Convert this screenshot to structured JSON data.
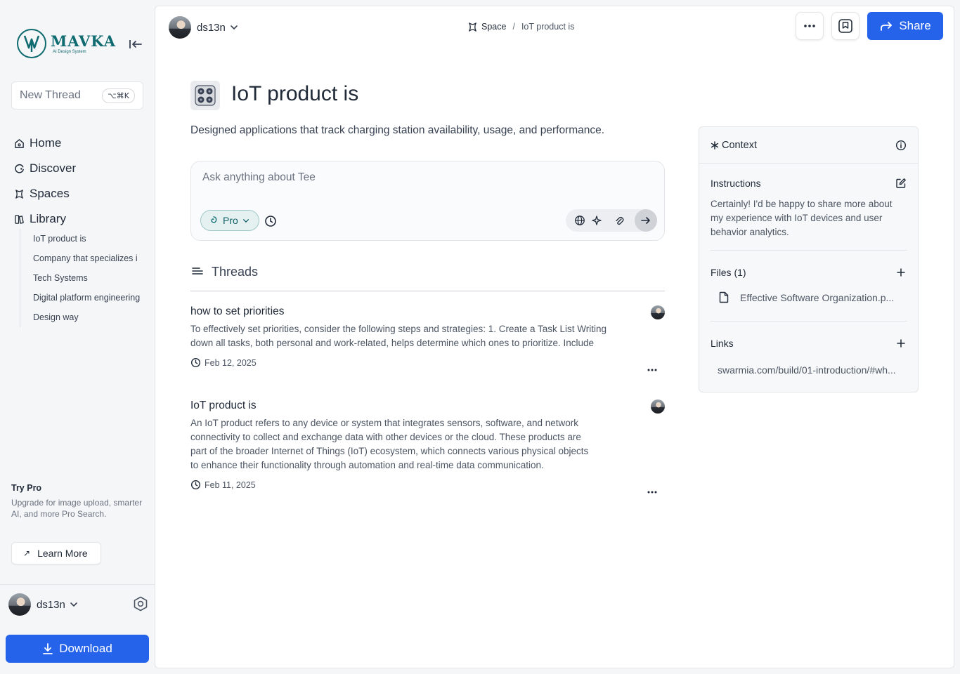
{
  "sidebar": {
    "brand_name": "MAVKA",
    "brand_tagline": "AI Design System",
    "new_thread": {
      "label": "New Thread",
      "shortcut": "⌥⌘K"
    },
    "nav": [
      {
        "label": "Home",
        "icon": "home-icon"
      },
      {
        "label": "Discover",
        "icon": "discover-icon"
      },
      {
        "label": "Spaces",
        "icon": "spaces-icon"
      },
      {
        "label": "Library",
        "icon": "library-icon"
      }
    ],
    "library_items": [
      "IoT product is",
      "Company that specializes i",
      "Tech Systems",
      "Digital platform engineering",
      "Design way"
    ],
    "try_pro": {
      "title": "Try Pro",
      "description": "Upgrade for image upload, smarter AI, and more Pro Search.",
      "button": "Learn More"
    },
    "user": {
      "name": "ds13n"
    },
    "download_label": "Download"
  },
  "header": {
    "user": "ds13n",
    "breadcrumb": {
      "space": "Space",
      "separator": "/",
      "current": "IoT product is"
    },
    "share_label": "Share"
  },
  "page": {
    "title": "IoT product is",
    "description": "Designed applications that track charging station availability, usage, and performance.",
    "ask_placeholder": "Ask anything about Tee",
    "mode_label": "Pro"
  },
  "threads": {
    "heading": "Threads",
    "items": [
      {
        "title": "how to set priorities",
        "body": "To effectively set priorities, consider the following steps and strategies: 1. Create a Task List Writing down all tasks, both personal and work-related, helps determine which ones to prioritize. Include",
        "date": "Feb 12, 2025"
      },
      {
        "title": "IoT product is",
        "body": "An IoT product refers to any device or system that integrates sensors, software, and network connectivity to collect and exchange data with other devices or the cloud. These products are part of the broader Internet of Things (IoT) ecosystem, which connects various physical objects to enhance their functionality through automation and real-time data communication.",
        "date": "Feb 11, 2025"
      }
    ]
  },
  "context": {
    "title": "Context",
    "instructions": {
      "title": "Instructions",
      "text": "Certainly! I'd be happy to share more about my experience with IoT devices and user behavior analytics."
    },
    "files": {
      "title": "Files (1)",
      "items": [
        "Effective Software Organization.p..."
      ]
    },
    "links": {
      "title": "Links",
      "items": [
        "swarmia.com/build/01-introduction/#wh..."
      ]
    }
  },
  "colors": {
    "accent": "#2563eb",
    "brand": "#0f6b70",
    "background": "#f5f6f8"
  }
}
